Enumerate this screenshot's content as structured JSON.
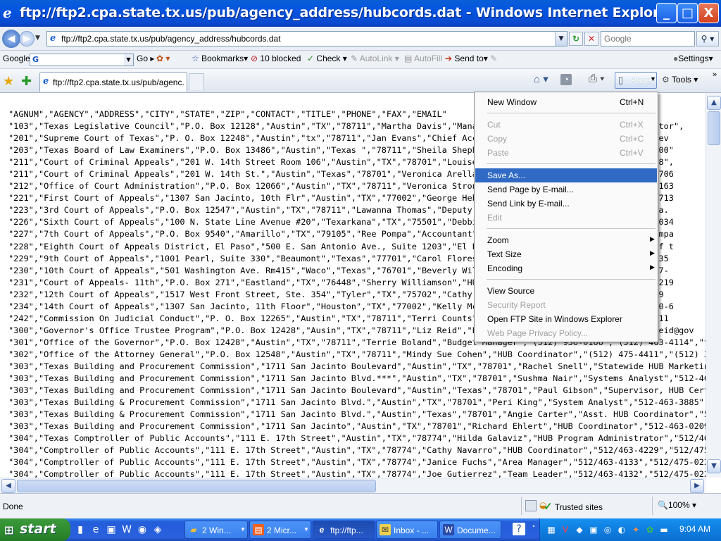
{
  "window": {
    "title": "ftp://ftp2.cpa.state.tx.us/pub/agency_address/hubcords.dat - Windows Internet Explorer",
    "minimize": "_",
    "maximize": "□",
    "close": "X"
  },
  "address_bar": {
    "url": "ftp://ftp2.cpa.state.tx.us/pub/agency_address/hubcords.dat",
    "search_placeholder": "Google"
  },
  "google_toolbar": {
    "logo": "Google",
    "go": "Go",
    "bookmarks": "Bookmarks",
    "blocked": "10 blocked",
    "check": "Check",
    "autolink": "AutoLink",
    "autofill": "AutoFill",
    "send_to": "Send to",
    "settings": "Settings"
  },
  "tabs": {
    "current": "ftp://ftp2.cpa.state.tx.us/pub/agenc...",
    "page": "Page",
    "tools": "Tools",
    "more": "»"
  },
  "content_lines": [
    "\"AGNUM\",\"AGENCY\",\"ADDRESS\",\"CITY\",\"STATE\",\"ZIP\",\"CONTACT\",\"TITLE\",\"PHONE\",\"FAX\",\"EMAIL\"",
    "\"103\",\"Texas Legislative Council\",\"P.O. Box 12128\",\"Austin\",\"TX\",\"78711\",\"Martha Davis\",\"Mana                              ordinator\",",
    "\"201\",\"Supreme Court of Texas\",\"P. O. Box 12248\",\"Austin\",\"tx\",\"78711\",\"Jan Evans\",\"Chief Acc                              ,\"jan.ev",
    "\"203\",\"Texas Board of Law Examiners\",\"P.O. Box 13486\",\"Austin\",\"Texas \",\"78711\",\"Sheila Sheph                              463-5300\"",
    "\"211\",\"Court of Criminal Appeals\",\"201 W. 14th Street Room 106\",\"Austin\",\"TX\",\"78701\",\"Louise                              36-1618\",",
    "\"211\",\"Court of Criminal Appeals\",\"201 W. 14th St.\",\"Austin\",\"Texas\",\"78701\",\"Veronica Arella                              2-463-706",
    "\"212\",\"Office of Court Administration\",\"P.O. Box 12066\",\"Austin\",\"TX\",\"78711\",\"Veronica Stron                              2/463-163",
    "\"221\",\"First Court of Appeals\",\"1307 San Jacinto, 10th Flr\",\"Austin\",\"TX\",\"77002\",\"George Heb                              act\",\"713",
    "\"223\",\"3rd Court of Appeals\",\"P.O. Box 12547\",\"Austin\",\"TX\",\"78711\",\"Lawanna Thomas\",\"Deputy                               lawanna.",
    "\"226\",\"Sixth Court of Appeals\",\"100 N. State Line Avenue #20\",\"Texarkana\",\"TX\",\"75501\",\"Debbi                              /798-3034",
    "\"227\",\"7th Court of Appeals\",\"P.O. Box 9540\",\"Amarillo\",\"TX\",\"79105\",\"Ree Pompa\",\"Accountant\"                              ree.pompa",
    "\"228\",\"Eighth Court of Appeals District, El Paso\",\"500 E. San Antonio Ave., Suite 1203\",\"El P                              lerk of t",
    "\"229\",\"9th Court of Appeals\",\"1001 Pearl, Suite 330\",\"Beaumont\",\"Texas\",\"77701\",\"Carol Flores                              \"409-835",
    "\"230\",\"10th Court of Appeals\",\"501 Washington Ave. Rm415\",\"Waco\",\"Texas\",\"76701\",\"Beverly Wil                              254-757-",
    "\"231\",\"Court of Appeals- 11th\",\"P.O. Box 271\",\"Eastland\",\"TX\",\"76448\",\"Sherry Williamson\",\"HU                              ) 629-219",
    "\"232\",\"12th Court of Appeals\",\"1517 West Front Street, Ste. 354\",\"Tyler\",\"TX\",\"75702\",\"Cathy                               \"903-59",
    "\"234\",\"14th Court of Appeals\",\"1307 San Jacinto, 11th Floor\",\"Houston\",\"TX\",\"77002\",\"Kelly Mc                              713/650-6",
    "\"242\",\"Commission On Judicial Conduct\",\"P. O. Box 12265\",\"Austin\",\"TX\",\"78711\",\"Terri Counts\"                              463-0511",
    "\"300\",\"Governor's Office Trustee Program\",\"P.O. Box 12428\",\"Ausin\",\"TX\",\"78711\",\"Liz Reid\",\"Purch                              lreid@gov",
    "\"301\",\"Office of the Governor\",\"P.O. Box 12428\",\"Austin\",\"TX\",\"78711\",\"Terrie Boland\",\"Budget Manager\",\"(512) 936-0166\",\"(512) 463-4114\",\"t",
    "\"302\",\"Office of the Attorney General\",\"P.O. Box 12548\",\"Austin\",\"TX\",\"78711\",\"Mindy Sue Cohen\",\"HUB Coordinator\",\"(512) 475-4411\",\"(512) 3",
    "\"303\",\"Texas Building and Procurement Commission\",\"1711 San Jacinto Boulevard\",\"Austin\",\"TX\",\"78701\",\"Rachel Snell\",\"Statewide HUB Marketin",
    "\"303\",\"Texas Building and Procurement Commission\",\"1711 San Jacinto Blvd.***\",\"Austin\",\"TX\",\"78701\",\"Sushma Nair\",\"Systems Analyst\",\"512-46",
    "\"303\",\"Texas Building and Procurement Commission\",\"1711 San Jacinto Boulevard\",\"Austin\",\"Texas\",\"78701\",\"Paul Gibson\",\"Supervisor, HUB Cert",
    "\"303\",\"Texas Building & Procurement Commission\",\"1711 San Jacinto Blvd.\",\"Austin\",\"TX\",\"78701\",\"Peri King\",\"System Analyst\",\"512-463-3885\",",
    "\"303\",\"Texas Building & Procurement Commission\",\"1711 San Jacinto Blvd.\",\"Austin\",\"Texas\",\"78701\",\"Angie Carter\",\"Asst. HUB Coordinator\",\"5",
    "\"303\",\"Texas Building and Procurement Commission\",\"1711 San Jacinto\",\"Austin\",\"TX\",\"78701\",\"Richard Ehlert\",\"HUB Coordinator\",\"512-463-0209",
    "\"304\",\"Texas Comptroller of Public Accounts\",\"111 E. 17th Street\",\"Austin\",\"TX\",\"78774\",\"Hilda Galaviz\",\"HUB Program Administrator\",\"512/46",
    "\"304\",\"Comptroller of Public Accounts\",\"111 E. 17th Street\",\"Austin\",\"TX\",\"78774\",\"Cathy Navarro\",\"HUB Coordinator\",\"512/463-4229\",\"512/475",
    "\"304\",\"Comptroller of Public Accounts\",\"111 E. 17th Street\",\"Austin\",\"TX\",\"78774\",\"Janice Fuchs\",\"Area Manager\",\"512/463-4133\",\"512/475-022",
    "\"304\",\"Comptroller of Public Accounts\",\"111 E. 17th Street\",\"Austin\",\"TX\",\"78774\",\"Joe Gutierrez\",\"Team Leader\",\"512/463-4132\",\"512/475-022"
  ],
  "page_menu": {
    "new_window": "New Window",
    "new_window_key": "Ctrl+N",
    "cut": "Cut",
    "cut_key": "Ctrl+X",
    "copy": "Copy",
    "copy_key": "Ctrl+C",
    "paste": "Paste",
    "paste_key": "Ctrl+V",
    "save_as": "Save As...",
    "send_page": "Send Page by E-mail...",
    "send_link": "Send Link by E-mail...",
    "edit": "Edit",
    "zoom": "Zoom",
    "text_size": "Text Size",
    "encoding": "Encoding",
    "view_source": "View Source",
    "security_report": "Security Report",
    "open_ftp": "Open FTP Site in Windows Explorer",
    "privacy_policy": "Web Page Privacy Policy..."
  },
  "status": {
    "text": "Done",
    "zone": "Trusted sites",
    "zoom": "100%"
  },
  "taskbar": {
    "start": "start",
    "task1": "2 Win...",
    "task2": "2 Micr...",
    "task3": "ftp://ftp...",
    "task4": "Inbox - ...",
    "task5": "Docume...",
    "clock": "9:04 AM"
  },
  "colors": {
    "titlebar": "#0454e0",
    "menu_highlight": "#316ac5",
    "start_button": "#2f8d2f"
  }
}
